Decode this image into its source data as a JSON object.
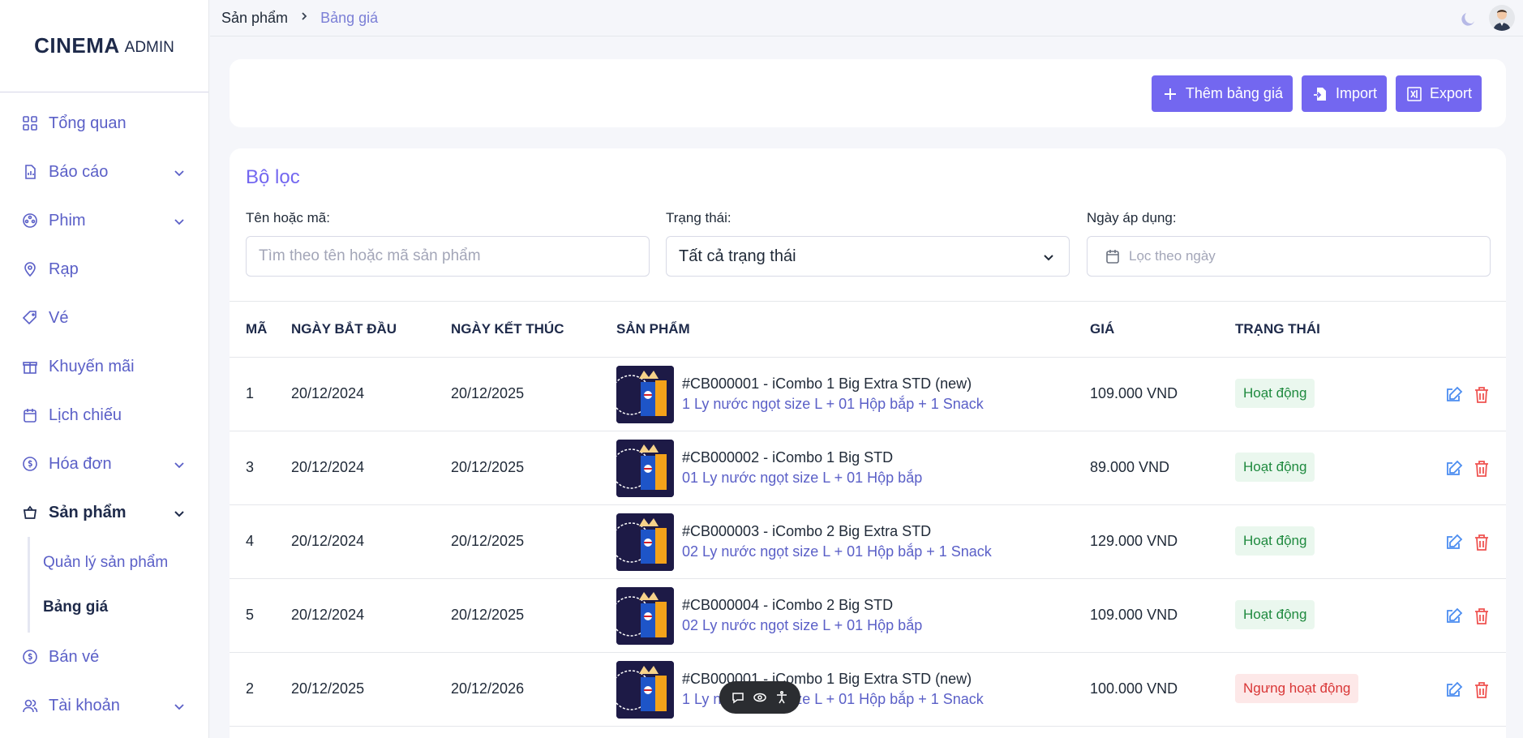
{
  "sidebar": {
    "brand": "CINEMA",
    "brand_sub": "ADMIN",
    "items": [
      {
        "label": "Tổng quan",
        "icon": "grid-icon"
      },
      {
        "label": "Báo cáo",
        "icon": "report-icon"
      },
      {
        "label": "Phim",
        "icon": "film-icon"
      },
      {
        "label": "Rạp",
        "icon": "location-icon"
      },
      {
        "label": "Vé",
        "icon": "ticket-icon"
      },
      {
        "label": "Khuyến mãi",
        "icon": "gift-icon"
      },
      {
        "label": "Lịch chiếu",
        "icon": "calendar-icon"
      },
      {
        "label": "Hóa đơn",
        "icon": "coin-icon"
      },
      {
        "label": "Sản phẩm",
        "icon": "basket-icon"
      },
      {
        "label": "Bán vé",
        "icon": "coin-icon"
      },
      {
        "label": "Tài khoản",
        "icon": "users-icon"
      }
    ],
    "submenu": [
      {
        "label": "Quản lý sản phẩm"
      },
      {
        "label": "Bảng giá"
      }
    ]
  },
  "breadcrumb": {
    "parent": "Sản phẩm",
    "current": "Bảng giá"
  },
  "actions": {
    "add_label": "Thêm bảng giá",
    "import_label": "Import",
    "export_label": "Export"
  },
  "filter": {
    "title": "Bộ lọc",
    "name_label": "Tên hoặc mã:",
    "name_placeholder": "Tìm theo tên hoặc mã sản phẩm",
    "status_label": "Trạng thái:",
    "status_value": "Tất cả trạng thái",
    "date_label": "Ngày áp dụng:",
    "date_placeholder": "Lọc theo ngày"
  },
  "table": {
    "headers": [
      "MÃ",
      "NGÀY BẮT ĐẦU",
      "NGÀY KẾT THÚC",
      "SẢN PHẨM",
      "GIÁ",
      "TRẠNG THÁI"
    ],
    "rows": [
      {
        "id": "1",
        "start": "20/12/2024",
        "end": "20/12/2025",
        "name": "#CB000001 - iCombo 1 Big Extra STD (new)",
        "desc": "1 Ly nước ngọt size L + 01 Hộp bắp + 1 Snack",
        "price": "109.000 VND",
        "status": "Hoạt động",
        "active": true
      },
      {
        "id": "3",
        "start": "20/12/2024",
        "end": "20/12/2025",
        "name": "#CB000002 - iCombo 1 Big STD",
        "desc": "01 Ly nước ngọt size L + 01 Hộp bắp",
        "price": "89.000 VND",
        "status": "Hoạt động",
        "active": true
      },
      {
        "id": "4",
        "start": "20/12/2024",
        "end": "20/12/2025",
        "name": "#CB000003 - iCombo 2 Big Extra STD",
        "desc": "02 Ly nước ngọt size L + 01 Hộp bắp + 1 Snack",
        "price": "129.000 VND",
        "status": "Hoạt động",
        "active": true
      },
      {
        "id": "5",
        "start": "20/12/2024",
        "end": "20/12/2025",
        "name": "#CB000004 - iCombo 2 Big STD",
        "desc": "02 Ly nước ngọt size L + 01 Hộp bắp",
        "price": "109.000 VND",
        "status": "Hoạt động",
        "active": true
      },
      {
        "id": "2",
        "start": "20/12/2025",
        "end": "20/12/2026",
        "name": "#CB000001 - iCombo 1 Big Extra STD (new)",
        "desc": "1 Ly nước ngọt size L + 01 Hộp bắp + 1 Snack",
        "price": "100.000 VND",
        "status": "Ngưng hoạt động",
        "active": false
      }
    ]
  },
  "colors": {
    "accent": "#7367f0",
    "active_badge": "#1f8a3f",
    "inactive_badge": "#d93636"
  }
}
